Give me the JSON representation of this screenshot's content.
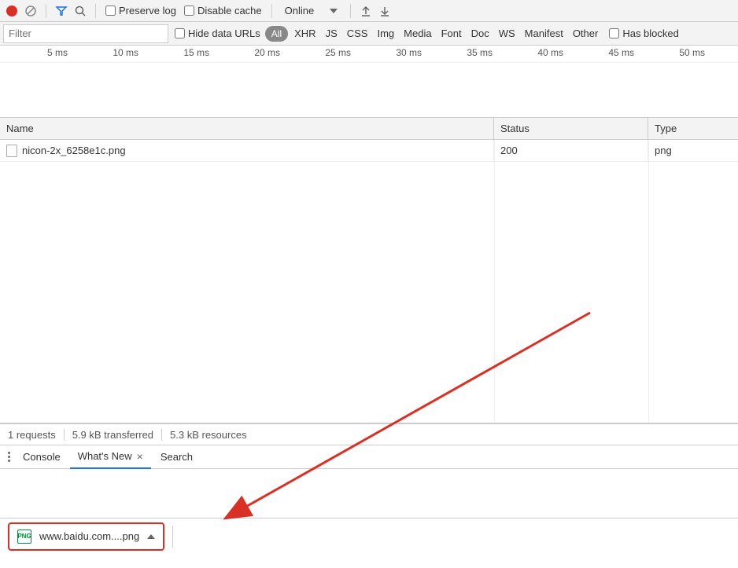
{
  "toolbar": {
    "preserve_log_label": "Preserve log",
    "disable_cache_label": "Disable cache",
    "throttling": "Online"
  },
  "filter": {
    "placeholder": "Filter",
    "hide_data_urls_label": "Hide data URLs",
    "types": {
      "all": "All",
      "xhr": "XHR",
      "js": "JS",
      "css": "CSS",
      "img": "Img",
      "media": "Media",
      "font": "Font",
      "doc": "Doc",
      "ws": "WS",
      "manifest": "Manifest",
      "other": "Other"
    },
    "has_blocked_label": "Has blocked"
  },
  "timeline": {
    "labels": [
      "5 ms",
      "10 ms",
      "15 ms",
      "20 ms",
      "25 ms",
      "30 ms",
      "35 ms",
      "40 ms",
      "45 ms",
      "50 ms"
    ]
  },
  "table": {
    "headers": {
      "name": "Name",
      "status": "Status",
      "type": "Type"
    },
    "rows": [
      {
        "name": "nicon-2x_6258e1c.png",
        "status": "200",
        "type": "png"
      }
    ]
  },
  "summary": {
    "requests": "1 requests",
    "transferred": "5.9 kB transferred",
    "resources": "5.3 kB resources"
  },
  "drawer": {
    "tabs": {
      "console": "Console",
      "whats_new": "What's New",
      "search": "Search"
    }
  },
  "download": {
    "filename": "www.baidu.com....png"
  }
}
